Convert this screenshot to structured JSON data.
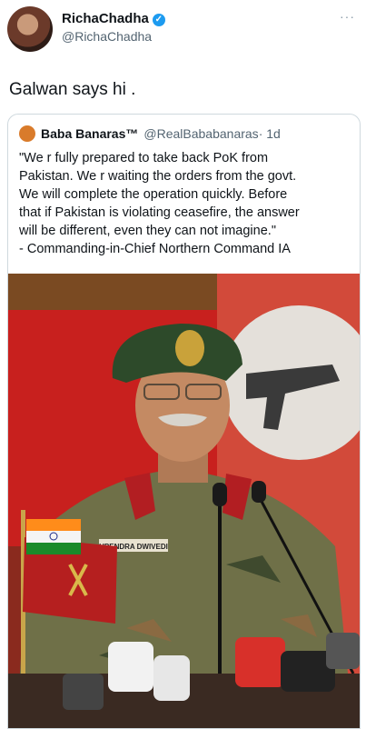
{
  "tweet": {
    "display_name": "RichaChadha",
    "handle": "@RichaChadha",
    "more_icon": "more-dots-icon",
    "text": "Galwan says hi ."
  },
  "quoted": {
    "name": "Baba Banaras™",
    "handle": "@RealBababanaras",
    "time": "· 1d",
    "lines": [
      "\"We r fully prepared to take back PoK from",
      "Pakistan. We r waiting the orders from the govt.",
      "We will complete the operation quickly. Before",
      "that if Pakistan is violating ceasefire, the answer",
      "will be different, even they can not imagine.\"",
      "- Commanding-in-Chief Northern Command IA"
    ],
    "name_tape": "UPENDRA DWIVEDI"
  },
  "colors": {
    "verified": "#1d9bf0",
    "handle": "#536471",
    "border": "#cfd9de"
  }
}
